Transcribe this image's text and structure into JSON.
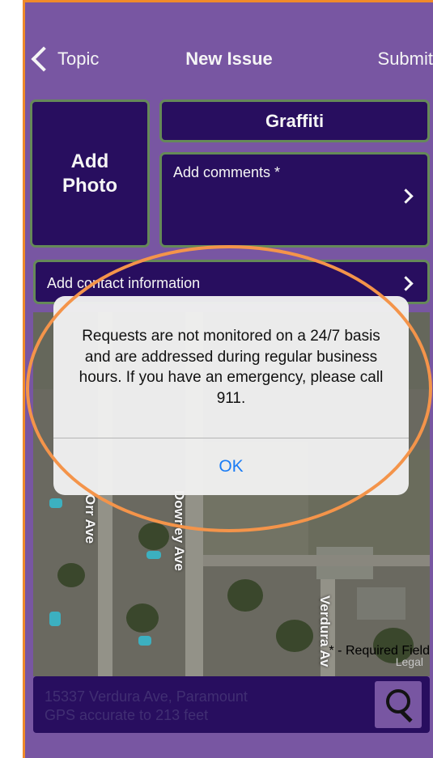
{
  "nav": {
    "back_label": "Topic",
    "title": "New Issue",
    "submit_label": "Submit"
  },
  "form": {
    "add_photo_label": "Add\nPhoto",
    "category": "Graffiti",
    "comments_label": "Add comments *",
    "contact_label": "Add contact information"
  },
  "map": {
    "streets": [
      "Verdura Av",
      "Downey Ave",
      "Orr Ave"
    ],
    "legal_label": "Legal"
  },
  "location": {
    "address": "15337 Verdura Ave, Paramount",
    "accuracy": "GPS accurate to 213 feet"
  },
  "footer": {
    "required_note": "* - Required Field"
  },
  "dialog": {
    "message": "Requests are not monitored on a 24/7 basis and are addressed during regular business hours. If you have an emergency, please call 911.",
    "ok_label": "OK"
  },
  "colors": {
    "purple_header": "#7d5aa9",
    "dark_purple": "#2a0f63",
    "accent_blue": "#1a7cf5",
    "highlight_orange": "#f4944a"
  }
}
